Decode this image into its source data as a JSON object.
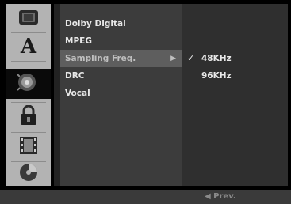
{
  "sidebar": {
    "icons": [
      {
        "name": "screen-icon"
      },
      {
        "name": "language-icon",
        "glyph": "A"
      },
      {
        "name": "audio-icon"
      },
      {
        "name": "lock-icon"
      },
      {
        "name": "film-icon"
      },
      {
        "name": "disc-icon"
      }
    ],
    "active_index": 2
  },
  "menu": {
    "items": [
      {
        "label": "Dolby Digital"
      },
      {
        "label": "MPEG"
      },
      {
        "label": "Sampling Freq.",
        "arrow": "▶"
      },
      {
        "label": "DRC"
      },
      {
        "label": "Vocal"
      }
    ],
    "selected_index": 2
  },
  "submenu": {
    "options": [
      {
        "label": "48KHz",
        "check": "✓"
      },
      {
        "label": "96KHz"
      }
    ]
  },
  "footer": {
    "prev_label": "◀ Prev."
  },
  "colors": {
    "background": "#000000",
    "icon_bar": "#b3b3b3",
    "menu_bg": "#3c3c3c",
    "selected_bg": "#5e5e5e",
    "text": "#e8e8e8"
  }
}
